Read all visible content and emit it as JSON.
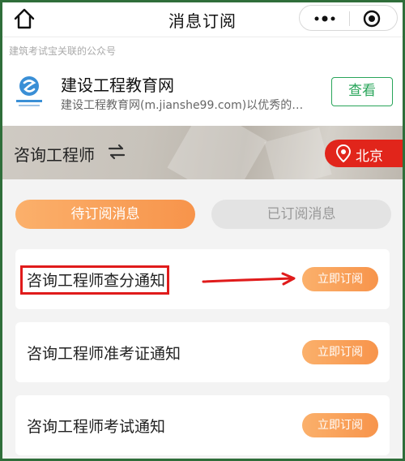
{
  "nav": {
    "title": "消息订阅",
    "icons": {
      "home": "home-icon",
      "more": "more-dots-icon",
      "target": "target-icon"
    }
  },
  "official_account": {
    "header": "建筑考试宝关联的公众号",
    "name": "建设工程教育网",
    "description": "建设工程教育网(m.jianshe99.com)以优秀的…",
    "view_label": "查看",
    "accent": "#29a55a"
  },
  "banner": {
    "title": "咨询工程师",
    "switch_icon": "switch-arrows-icon",
    "city": "北京",
    "city_color": "#e1251b"
  },
  "tabs": [
    {
      "label": "待订阅消息",
      "active": true
    },
    {
      "label": "已订阅消息",
      "active": false
    }
  ],
  "subscriptions": [
    {
      "title": "咨询工程师查分通知",
      "button": "立即订阅"
    },
    {
      "title": "咨询工程师准考证通知",
      "button": "立即订阅"
    },
    {
      "title": "咨询工程师考试通知",
      "button": "立即订阅"
    }
  ],
  "accent": "#f7944b",
  "annotation_color": "#e01b1b"
}
